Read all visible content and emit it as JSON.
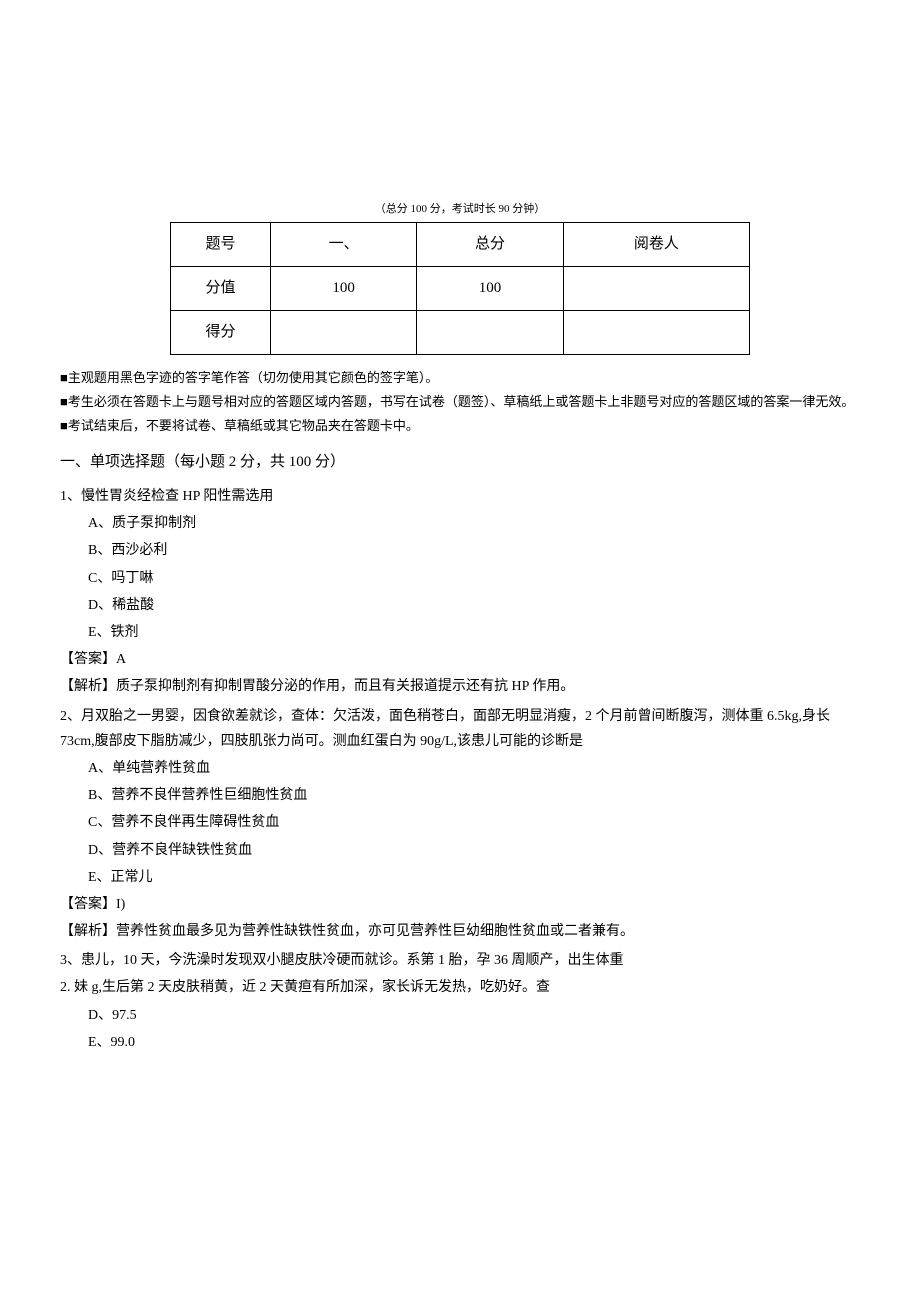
{
  "header_note": "（总分 100 分，考试时长 90 分钟）",
  "table": {
    "headers": [
      "题号",
      "一、",
      "总分",
      "阅卷人"
    ],
    "row1": [
      "分值",
      "100",
      "100",
      ""
    ],
    "row2": [
      "得分",
      "",
      "",
      ""
    ]
  },
  "instructions": {
    "line1": "■主观题用黑色字迹的答字笔作答（切勿使用其它颜色的签字笔）。",
    "line2": "■考生必须在答题卡上与题号相对应的答题区域内答题，书写在试卷（题签）、草稿纸上或答题卡上非题号对应的答题区域的答案一律无效。",
    "line3": "■考试结束后，不要将试卷、草稿纸或其它物品夹在答题卡中。"
  },
  "section_title": "一、单项选择题（每小题 2 分，共 100 分）",
  "q1": {
    "stem": "1、慢性胃炎经检查 HP 阳性需选用",
    "opts": {
      "a": "A、质子泵抑制剂",
      "b": "B、西沙必利",
      "c": "C、吗丁啉",
      "d": "D、稀盐酸",
      "e": "E、铁剂"
    },
    "answer": "【答案】A",
    "analysis": "【解析】质子泵抑制剂有抑制胃酸分泌的作用，而且有关报道提示还有抗 HP 作用。"
  },
  "q2": {
    "stem": "2、月双胎之一男婴，因食欲差就诊，查体：欠活泼，面色稍苍白，面部无明显消瘦，2 个月前曾间断腹泻，测体重 6.5kg,身长 73cm,腹部皮下脂肪减少，四肢肌张力尚可。测血红蛋白为 90g/L,该患儿可能的诊断是",
    "opts": {
      "a": "A、单纯营养性贫血",
      "b": "B、营养不良伴营养性巨细胞性贫血",
      "c": "C、营养不良伴再生障碍性贫血",
      "d": "D、营养不良伴缺铁性贫血",
      "e": "E、正常儿"
    },
    "answer": "【答案】I)",
    "analysis": "【解析】营养性贫血最多见为营养性缺铁性贫血，亦可见营养性巨幼细胞性贫血或二者兼有。"
  },
  "q3": {
    "stem1": "3、患儿，10 天，今洗澡时发现双小腿皮肤冷硬而就诊。系第 1 胎，孕 36 周顺产，出生体重",
    "stem2": "2. 妹 g,生后第 2 天皮肤稍黄，近 2 天黄疸有所加深，家长诉无发热，吃奶好。查",
    "opts": {
      "d": "D、97.5",
      "e": "E、99.0"
    }
  }
}
